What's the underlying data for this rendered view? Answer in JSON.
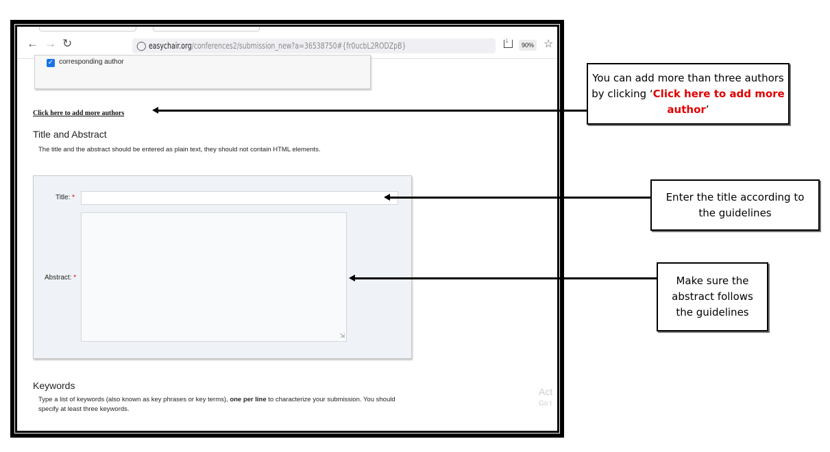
{
  "browser": {
    "url_host": "easychair.org",
    "url_path": "/conferences2/submission_new?a=36538750#{fr0ucbL2RODZpB}",
    "zoom": "90%"
  },
  "authors": {
    "checkbox_label": "corresponding author",
    "checkbox_checked": true,
    "add_more_link": "Click here to add more authors"
  },
  "title_abstract": {
    "heading": "Title and Abstract",
    "description": "The title and the abstract should be entered as plain text, they should not contain HTML elements.",
    "title_label": "Title:",
    "abstract_label": "Abstract:",
    "required_marker": "*",
    "title_value": "",
    "abstract_value": ""
  },
  "keywords": {
    "heading": "Keywords",
    "description_pre": "Type a list of keywords (also known as key phrases or key terms), ",
    "description_bold": "one per line",
    "description_post": " to characterize your submission. You should specify at least three keywords."
  },
  "watermark": {
    "line1": "Act",
    "line2": "Go t"
  },
  "callouts": {
    "add_authors": {
      "text_pre": "You can add more than three authors by clicking ‘",
      "text_red": "Click here to add more author",
      "text_post": "’"
    },
    "title": "Enter the title according to the guidelines",
    "abstract": "Make sure the abstract follows the guidelines"
  }
}
